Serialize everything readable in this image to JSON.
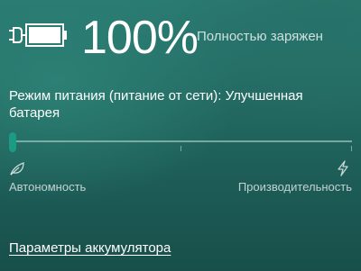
{
  "battery": {
    "icon": "battery-charging-icon",
    "percent_text": "100%",
    "status_text": "Полностью заряжен",
    "level": 1.0
  },
  "power_mode": {
    "label": "Режим питания (питание от сети): Улучшенная батарея",
    "slider_position": 0.0,
    "left_icon": "leaf-icon",
    "right_icon": "lightning-icon",
    "left_label": "Автономность",
    "right_label": "Производительность"
  },
  "links": {
    "battery_settings": "Параметры аккумулятора"
  },
  "colors": {
    "accent": "#1c9a84",
    "track": "#bee1da"
  }
}
